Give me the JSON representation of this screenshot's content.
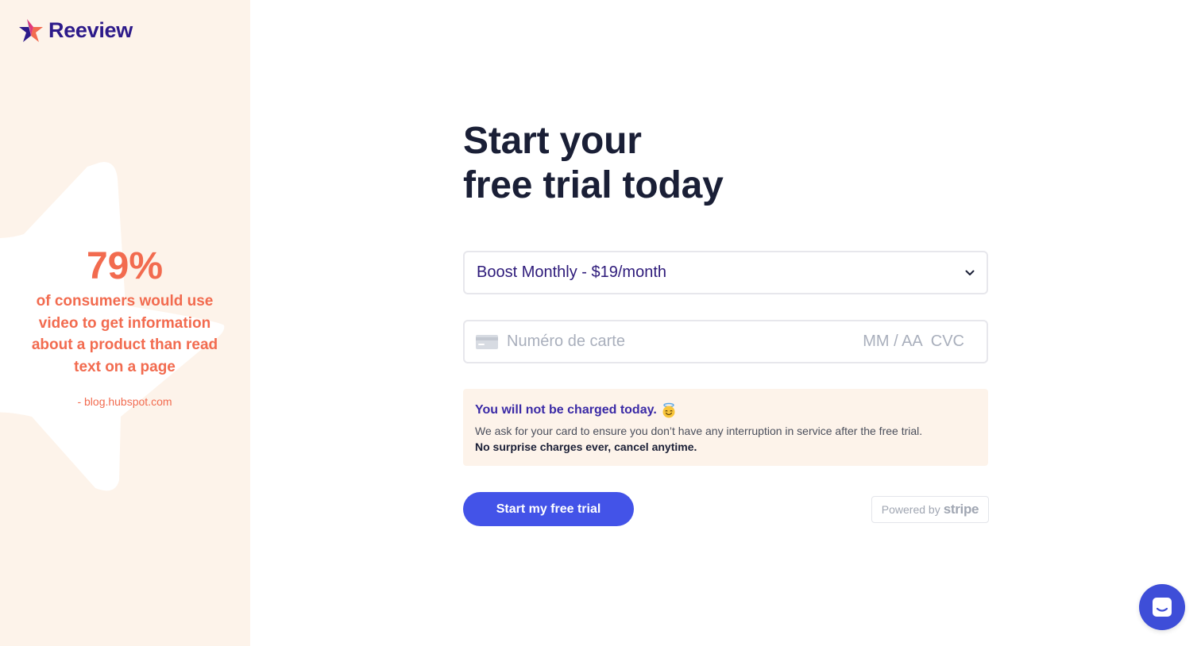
{
  "brand": {
    "name": "Reeview"
  },
  "sidebar": {
    "stat_value": "79%",
    "stat_text": "of consumers would use video to get information about a product than read text on a page",
    "stat_source": "- blog.hubspot.com"
  },
  "main": {
    "title_line1": "Start your",
    "title_line2": "free trial today",
    "plan_select": {
      "selected": "Boost Monthly - $19/month"
    },
    "card": {
      "number_placeholder": "Numéro de carte",
      "exp_placeholder": "MM / AA",
      "cvc_placeholder": "CVC"
    },
    "notice": {
      "title": "You will not be charged today.",
      "body": "We ask for your card to ensure you don’t have any interruption in service after the free trial.",
      "strong": "No surprise charges ever, cancel anytime."
    },
    "cta_label": "Start my free trial",
    "powered_by": {
      "prefix": "Powered by",
      "brand": "stripe"
    }
  },
  "colors": {
    "sidebar_bg": "#fdf3ea",
    "accent_orange": "#f26b4f",
    "brand_purple": "#2d1a8a",
    "cta_blue": "#4353e8",
    "chat_blue": "#3e4ed8"
  },
  "icons": {
    "logo": "star-logo-icon",
    "chevron": "chevron-down-icon",
    "card": "credit-card-icon",
    "emoji": "smiling-face-with-halo-icon",
    "chat": "chat-bubble-icon"
  }
}
